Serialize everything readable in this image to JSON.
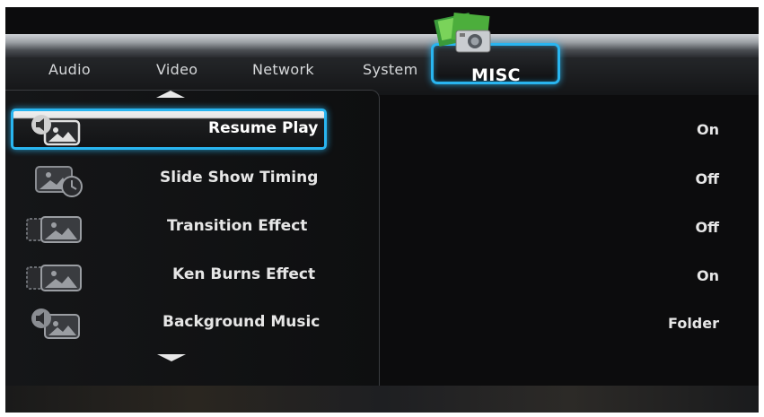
{
  "tabs": [
    {
      "label": "Audio"
    },
    {
      "label": "Video"
    },
    {
      "label": "Network"
    },
    {
      "label": "System"
    },
    {
      "label": "MISC"
    }
  ],
  "active_tab": "MISC",
  "menu": [
    {
      "label": "Resume Play",
      "value": "On",
      "icon": "speaker-photo-icon",
      "selected": true
    },
    {
      "label": "Slide Show Timing",
      "value": "Off",
      "icon": "photo-clock-icon",
      "selected": false
    },
    {
      "label": "Transition Effect",
      "value": "Off",
      "icon": "photo-transition-icon",
      "selected": false
    },
    {
      "label": "Ken Burns Effect",
      "value": "On",
      "icon": "photo-pan-icon",
      "selected": false
    },
    {
      "label": "Background Music",
      "value": "Folder",
      "icon": "speaker-photo-icon",
      "selected": false
    }
  ],
  "colors": {
    "highlight": "#29b5f0",
    "background": "#0c0c0d",
    "text": "#e6e6e6"
  }
}
